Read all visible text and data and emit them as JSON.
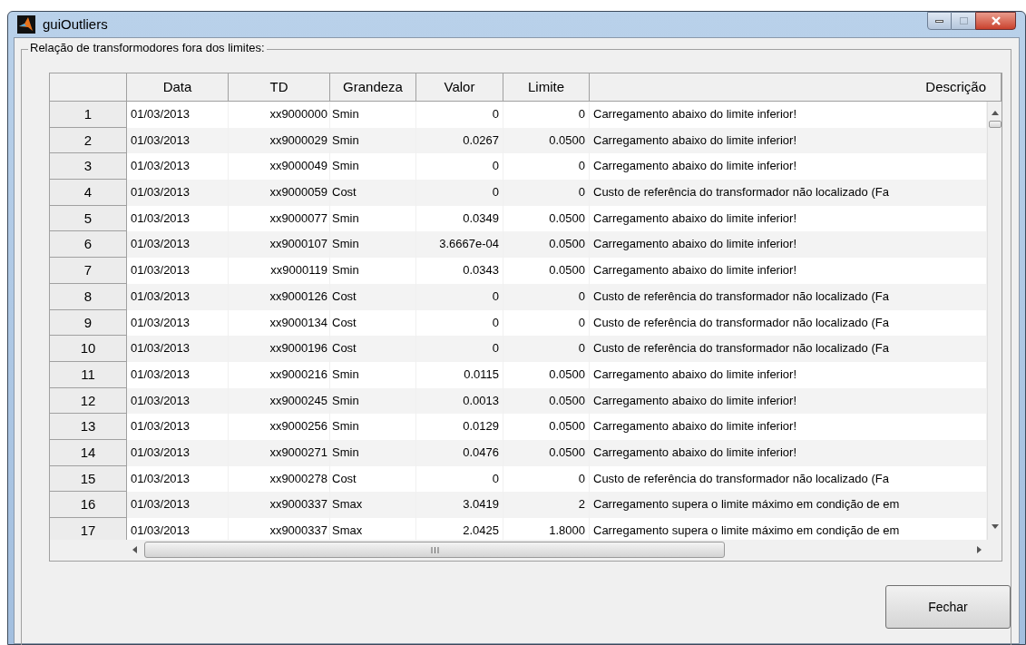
{
  "window": {
    "title": "guiOutliers"
  },
  "group": {
    "title": "Relação de transformodores fora dos limites:"
  },
  "table": {
    "columns": [
      "Data",
      "TD",
      "Grandeza",
      "Valor",
      "Limite",
      "Descrição"
    ],
    "rows": [
      {
        "index": "1",
        "cells": [
          "01/03/2013",
          "xx9000000",
          "Smin",
          "0",
          "0",
          "Carregamento abaixo do limite inferior!"
        ]
      },
      {
        "index": "2",
        "cells": [
          "01/03/2013",
          "xx9000029",
          "Smin",
          "0.0267",
          "0.0500",
          "Carregamento abaixo do limite inferior!"
        ]
      },
      {
        "index": "3",
        "cells": [
          "01/03/2013",
          "xx9000049",
          "Smin",
          "0",
          "0",
          "Carregamento abaixo do limite inferior!"
        ]
      },
      {
        "index": "4",
        "cells": [
          "01/03/2013",
          "xx9000059",
          "Cost",
          "0",
          "0",
          "Custo de referência do transformador não localizado (Fa"
        ]
      },
      {
        "index": "5",
        "cells": [
          "01/03/2013",
          "xx9000077",
          "Smin",
          "0.0349",
          "0.0500",
          "Carregamento abaixo do limite inferior!"
        ]
      },
      {
        "index": "6",
        "cells": [
          "01/03/2013",
          "xx9000107",
          "Smin",
          "3.6667e-04",
          "0.0500",
          "Carregamento abaixo do limite inferior!"
        ]
      },
      {
        "index": "7",
        "cells": [
          "01/03/2013",
          "xx9000119",
          "Smin",
          "0.0343",
          "0.0500",
          "Carregamento abaixo do limite inferior!"
        ]
      },
      {
        "index": "8",
        "cells": [
          "01/03/2013",
          "xx9000126",
          "Cost",
          "0",
          "0",
          "Custo de referência do transformador não localizado (Fa"
        ]
      },
      {
        "index": "9",
        "cells": [
          "01/03/2013",
          "xx9000134",
          "Cost",
          "0",
          "0",
          "Custo de referência do transformador não localizado (Fa"
        ]
      },
      {
        "index": "10",
        "cells": [
          "01/03/2013",
          "xx9000196",
          "Cost",
          "0",
          "0",
          "Custo de referência do transformador não localizado (Fa"
        ]
      },
      {
        "index": "11",
        "cells": [
          "01/03/2013",
          "xx9000216",
          "Smin",
          "0.0115",
          "0.0500",
          "Carregamento abaixo do limite inferior!"
        ]
      },
      {
        "index": "12",
        "cells": [
          "01/03/2013",
          "xx9000245",
          "Smin",
          "0.0013",
          "0.0500",
          "Carregamento abaixo do limite inferior!"
        ]
      },
      {
        "index": "13",
        "cells": [
          "01/03/2013",
          "xx9000256",
          "Smin",
          "0.0129",
          "0.0500",
          "Carregamento abaixo do limite inferior!"
        ]
      },
      {
        "index": "14",
        "cells": [
          "01/03/2013",
          "xx9000271",
          "Smin",
          "0.0476",
          "0.0500",
          "Carregamento abaixo do limite inferior!"
        ]
      },
      {
        "index": "15",
        "cells": [
          "01/03/2013",
          "xx9000278",
          "Cost",
          "0",
          "0",
          "Custo de referência do transformador não localizado (Fa"
        ]
      },
      {
        "index": "16",
        "cells": [
          "01/03/2013",
          "xx9000337",
          "Smax",
          "3.0419",
          "2",
          "Carregamento supera o limite máximo em condição de em"
        ]
      },
      {
        "index": "17",
        "cells": [
          "01/03/2013",
          "xx9000337",
          "Smax",
          "2.0425",
          "1.8000",
          "Carregamento supera o limite máximo em condição de em"
        ]
      }
    ]
  },
  "buttons": [
    "Fechar"
  ]
}
